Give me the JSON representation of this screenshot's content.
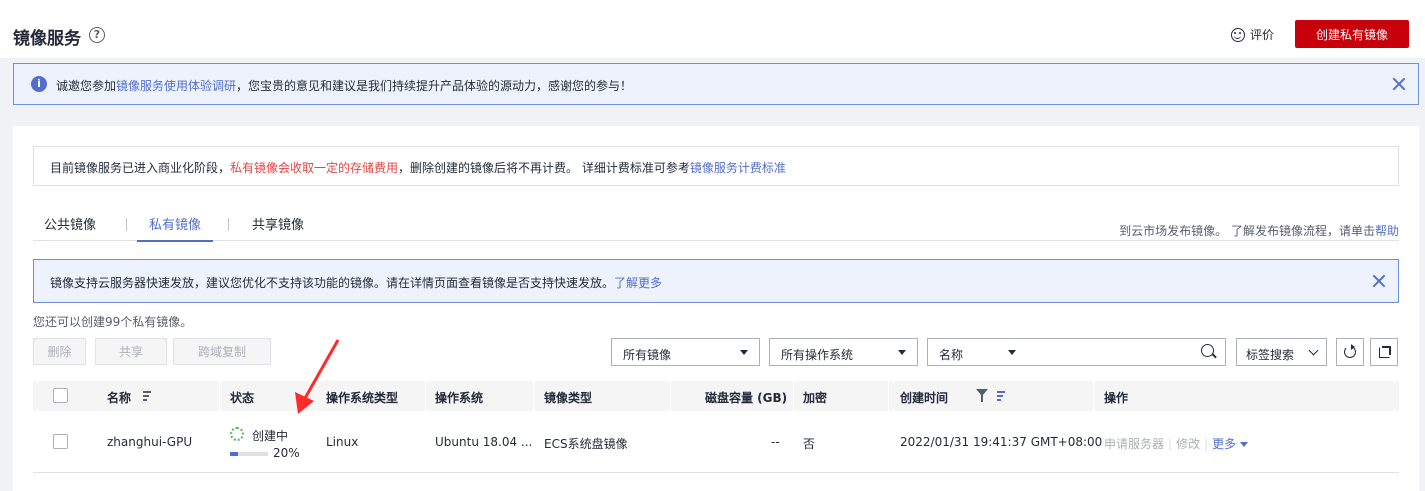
{
  "header": {
    "title": "镜像服务",
    "help_icon": "?",
    "rate_label": "评价",
    "create_button": "创建私有镜像"
  },
  "notice_top": {
    "prefix": "诚邀您参加",
    "link": "镜像服务使用体验调研",
    "suffix": "，您宝贵的意见和建议是我们持续提升产品体验的源动力，感谢您的参与！"
  },
  "billing": {
    "prefix": "目前镜像服务已进入商业化阶段，",
    "highlight": "私有镜像会收取一定的存储费用",
    "middle": "，删除创建的镜像后将不再计费。 详细计费标准可参考",
    "link": "镜像服务计费标准"
  },
  "tabs": [
    {
      "label": "公共镜像",
      "active": false
    },
    {
      "label": "私有镜像",
      "active": true
    },
    {
      "label": "共享镜像",
      "active": false
    }
  ],
  "tabs_right": {
    "link1": "到云市场发布镜像",
    "text": "。 了解发布镜像流程，请单击",
    "link2": "帮助"
  },
  "notice_fast": {
    "text": "镜像支持云服务器快速发放，建议您优化不支持该功能的镜像。请在详情页面查看镜像是否支持快速发放。",
    "link": "了解更多"
  },
  "quota": "您还可以创建99个私有镜像。",
  "actions": {
    "delete": "删除",
    "share": "共享",
    "copy": "跨域复制"
  },
  "filters": {
    "image_scope": "所有镜像",
    "os": "所有操作系统",
    "field": "名称",
    "search_value": "",
    "tag_search": "标签搜索"
  },
  "table": {
    "columns": [
      "名称",
      "状态",
      "操作系统类型",
      "操作系统",
      "镜像类型",
      "磁盘容量 (GB)",
      "加密",
      "创建时间",
      "操作"
    ],
    "rows": [
      {
        "name": "zhanghui-GPU",
        "status": "创建中",
        "progress_text": "20%",
        "progress": 20,
        "os_type": "Linux",
        "os": "Ubuntu 18.04 ...",
        "image_type": "ECS系统盘镜像",
        "disk": "--",
        "encrypted": "否",
        "created": "2022/01/31 19:41:37 GMT+08:00",
        "op_apply": "申请服务器",
        "op_modify": "修改",
        "op_more": "更多"
      }
    ]
  },
  "colors": {
    "brand_red": "#c7000b",
    "link_blue": "#526ecc",
    "warn_red": "#e54545",
    "annotation_red": "#ff2a2a"
  }
}
